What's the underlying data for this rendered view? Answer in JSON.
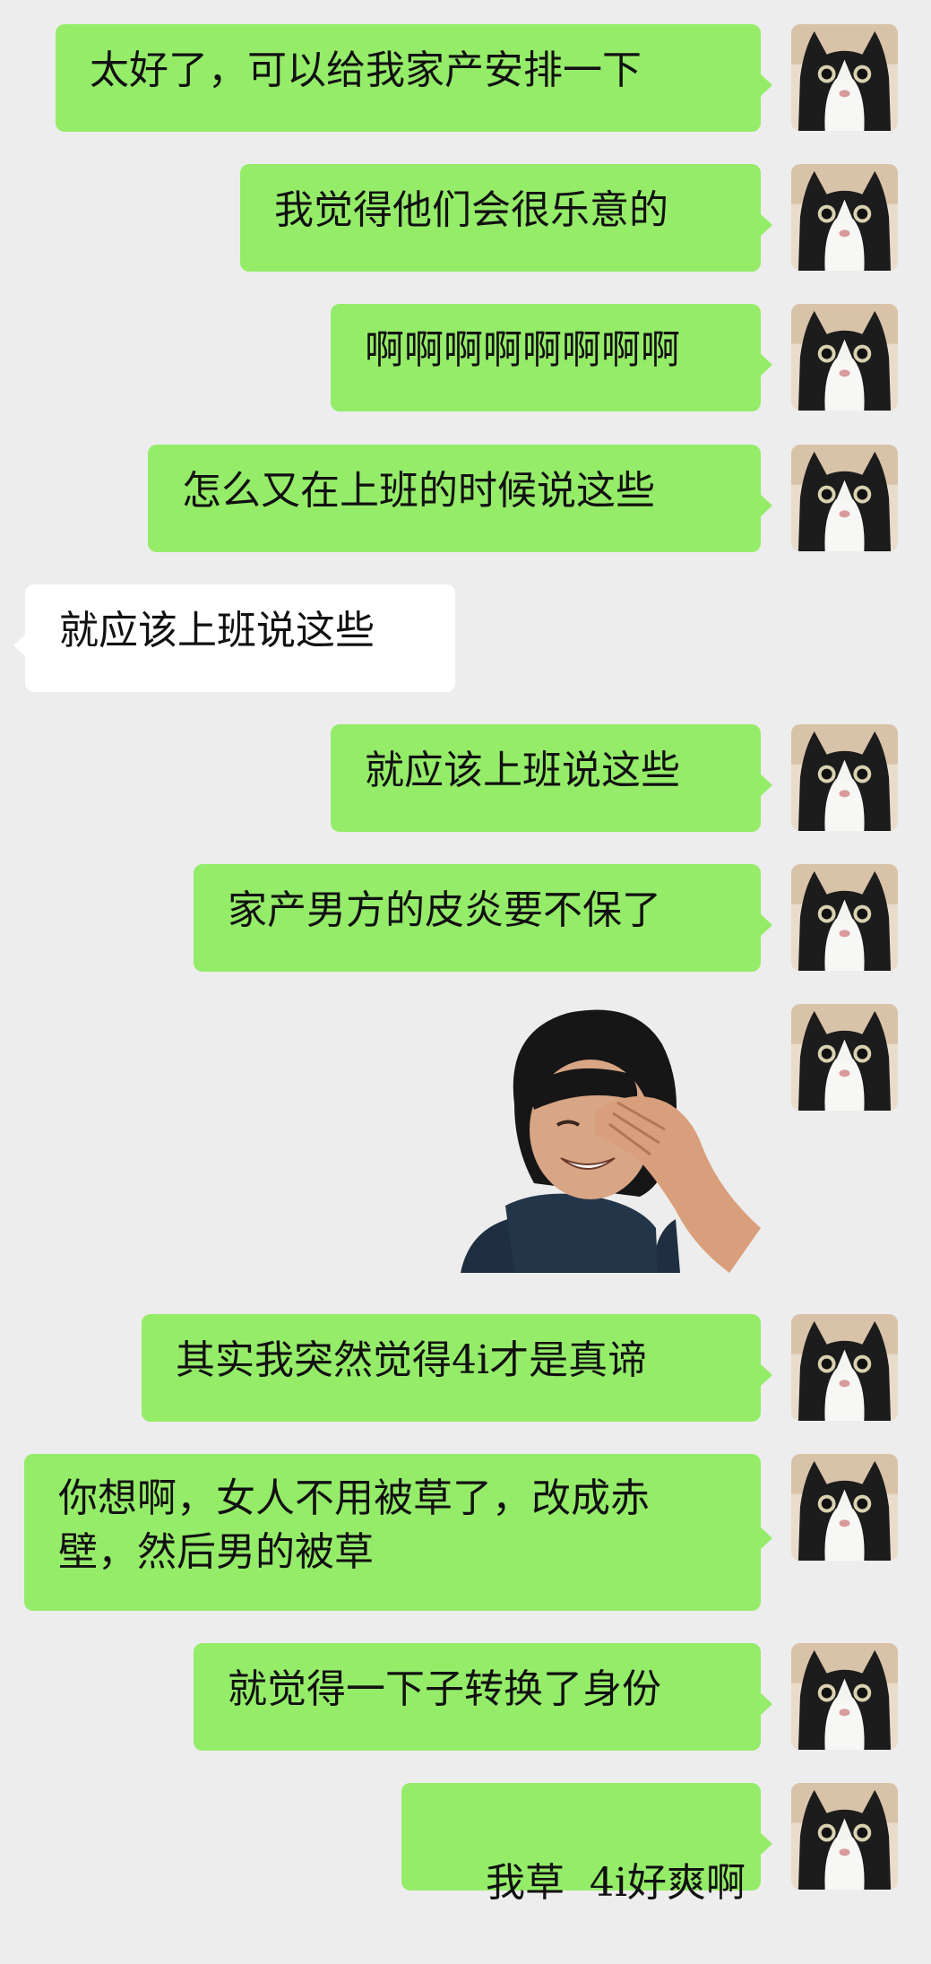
{
  "messages": [
    {
      "side": "me",
      "type": "text",
      "text": "太好了，可以给我家产安排一下"
    },
    {
      "side": "me",
      "type": "text",
      "text": "我觉得他们会很乐意的"
    },
    {
      "side": "me",
      "type": "text",
      "text": "啊啊啊啊啊啊啊啊"
    },
    {
      "side": "me",
      "type": "text",
      "text": "怎么又在上班的时候说这些"
    },
    {
      "side": "other",
      "type": "text",
      "text": "就应该上班说这些"
    },
    {
      "side": "me",
      "type": "text",
      "text": "就应该上班说这些"
    },
    {
      "side": "me",
      "type": "text",
      "text": "家产男方的皮炎要不保了"
    },
    {
      "side": "me",
      "type": "sticker",
      "sticker": "facepalm-laughing-person-sticker"
    },
    {
      "side": "me",
      "type": "text",
      "text": "其实我突然觉得4i才是真谛"
    },
    {
      "side": "me",
      "type": "text",
      "text": "你想啊，女人不用被草了，改成赤壁，然后男的被草"
    },
    {
      "side": "me",
      "type": "text",
      "text": "就觉得一下子转换了身份"
    },
    {
      "side": "me",
      "type": "text",
      "text": "我草  4i好爽啊"
    }
  ],
  "colors": {
    "background": "#ededed",
    "my_bubble": "#95ec69",
    "other_bubble": "#ffffff"
  },
  "icons": {
    "my_avatar": "cat-avatar"
  }
}
